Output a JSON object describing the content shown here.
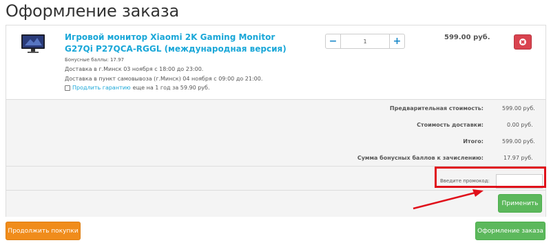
{
  "page": {
    "title": "Оформление заказа"
  },
  "product": {
    "title": "Игровой монитор Xiaomi 2K Gaming Monitor G27Qi P27QCA-RGGL (международная версия)",
    "bonus": "Бонусные баллы: 17.97",
    "delivery_home": "Доставка в г.Минск 03 ноября с 18:00 до 23:00.",
    "delivery_pickup": "Доставка в пункт самовывоза (г.Минск) 04 ноября с 09:00 до 21:00.",
    "warranty_link": "Продлить гарантию",
    "warranty_suffix": "еще на 1 год за 59.90 руб.",
    "quantity": "1",
    "minus_label": "−",
    "plus_label": "+",
    "price": "599.00 руб."
  },
  "summary": {
    "rows": [
      {
        "label": "Предварительная стоимость:",
        "value": "599.00 руб."
      },
      {
        "label": "Стоимость доставки:",
        "value": "0.00 руб."
      },
      {
        "label": "Итого:",
        "value": "599.00 руб."
      },
      {
        "label": "Сумма бонусных баллов к зачислению:",
        "value": "17.97 руб."
      }
    ]
  },
  "promo": {
    "label": "Введите промокод:",
    "value": "",
    "apply_label": "Применить"
  },
  "actions": {
    "continue_label": "Продолжить покупки",
    "checkout_label": "Оформление заказа"
  },
  "colors": {
    "link": "#1aa7d8",
    "remove": "#d9434f",
    "success": "#5cb85c",
    "warning": "#f08c1b",
    "highlight": "#e0101a"
  },
  "icons": {
    "remove": "close-circle-icon",
    "thumbnail": "monitor-icon"
  }
}
